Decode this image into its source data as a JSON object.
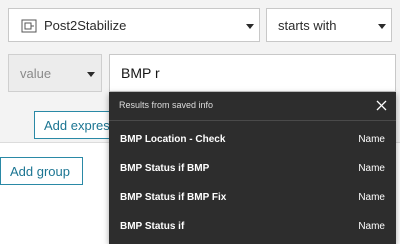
{
  "filter": {
    "field_select": {
      "value": "Post2Stabilize",
      "icon": "layer-field-icon"
    },
    "operator_select": {
      "value": "starts with"
    },
    "value_type_select": {
      "value": "value"
    },
    "value_input": {
      "value": "BMP r"
    }
  },
  "buttons": {
    "add_expression": "Add expression",
    "add_group": "Add group"
  },
  "suggestions": {
    "header": "Results from saved info",
    "items": [
      {
        "value": "BMP Location - Check",
        "kind": "Name"
      },
      {
        "value": "BMP Status if BMP",
        "kind": "Name"
      },
      {
        "value": "BMP Status if BMP Fix",
        "kind": "Name"
      },
      {
        "value": "BMP Status if",
        "kind": "Name"
      }
    ]
  },
  "colors": {
    "accent": "#2a89a6",
    "dropdown_bg": "#2d2d2d",
    "panel_bg": "#f3f3f3"
  }
}
